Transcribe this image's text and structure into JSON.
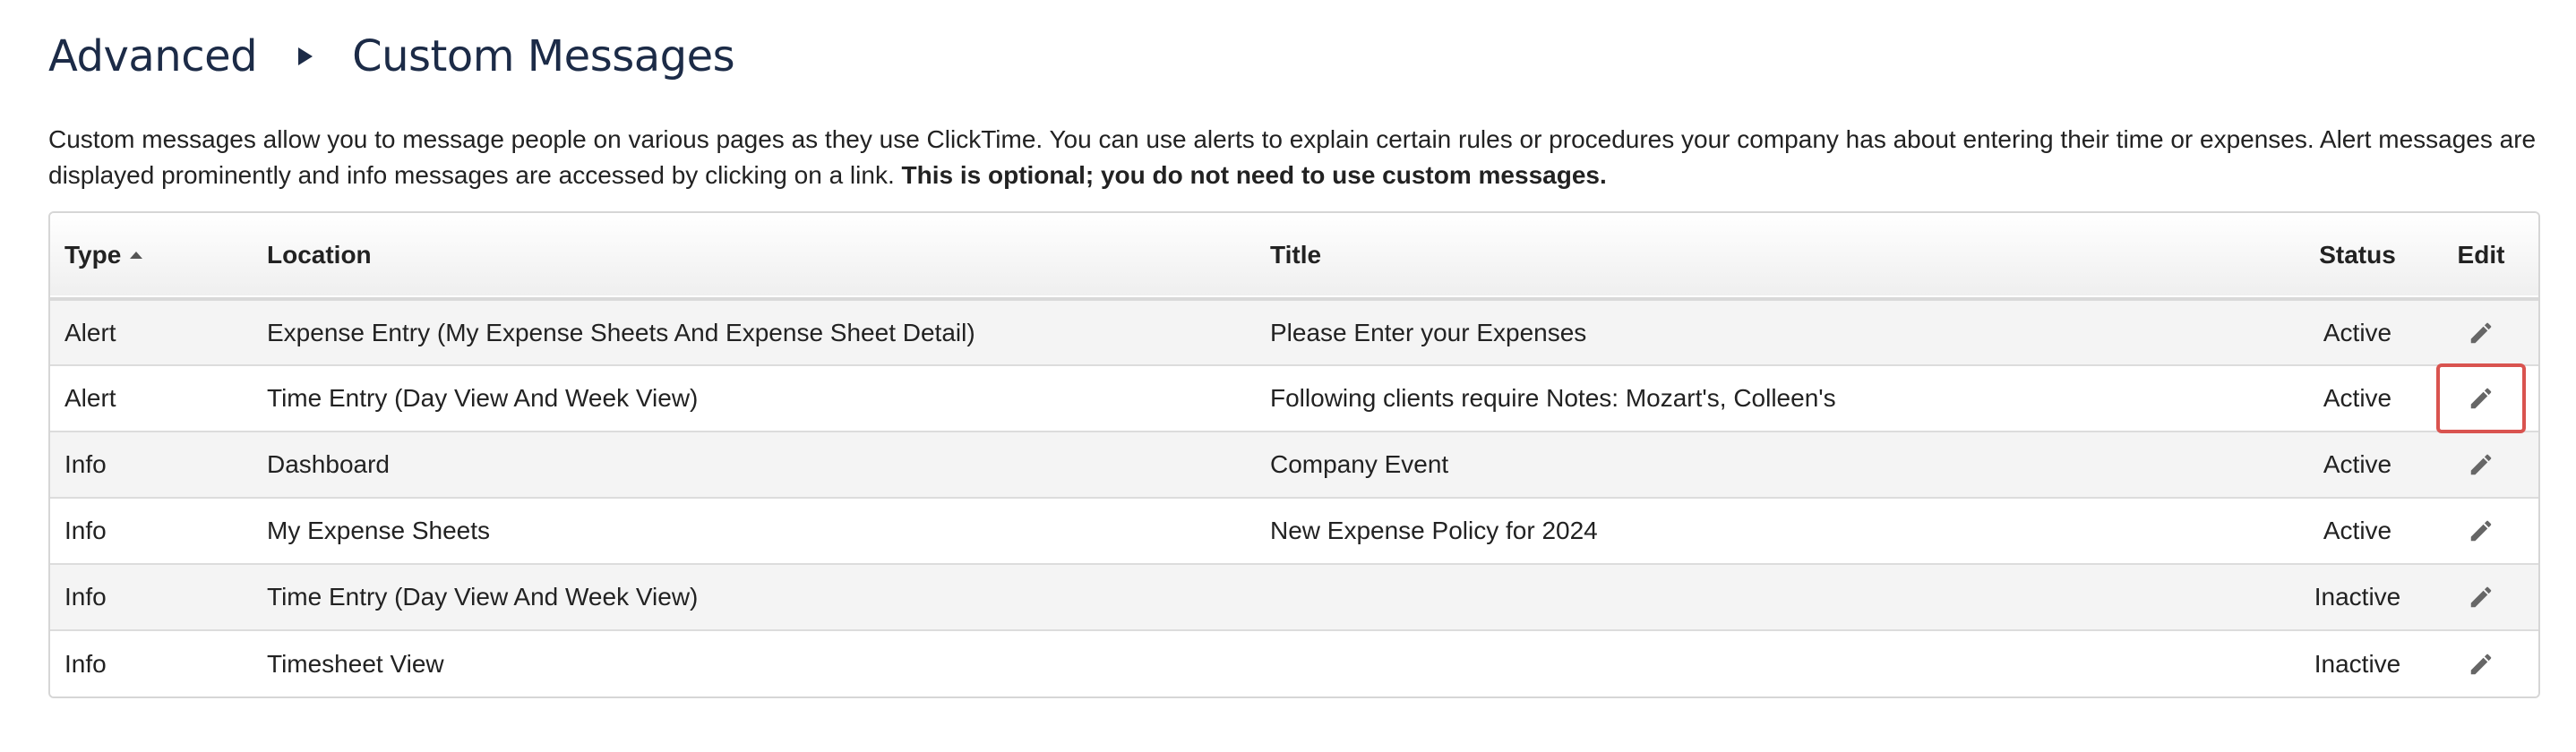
{
  "breadcrumb": {
    "parent": "Advanced",
    "current": "Custom Messages"
  },
  "description": {
    "text": "Custom messages allow you to message people on various pages as they use ClickTime. You can use alerts to explain certain rules or procedures your company has about entering their time or expenses. Alert messages are displayed prominently and info messages are accessed by clicking on a link. ",
    "bold": "This is optional; you do not need to use custom messages."
  },
  "table": {
    "headers": {
      "type": "Type",
      "location": "Location",
      "title": "Title",
      "status": "Status",
      "edit": "Edit"
    },
    "sort": {
      "column": "type",
      "direction": "ascending"
    },
    "rows": [
      {
        "type": "Alert",
        "location": "Expense Entry (My Expense Sheets And Expense Sheet Detail)",
        "title": "Please Enter your Expenses",
        "status": "Active"
      },
      {
        "type": "Alert",
        "location": "Time Entry (Day View And Week View)",
        "title": "Following clients require Notes: Mozart's, Colleen's",
        "status": "Active"
      },
      {
        "type": "Info",
        "location": "Dashboard",
        "title": "Company Event",
        "status": "Active"
      },
      {
        "type": "Info",
        "location": "My Expense Sheets",
        "title": "New Expense Policy for 2024",
        "status": "Active"
      },
      {
        "type": "Info",
        "location": "Time Entry (Day View And Week View)",
        "title": "",
        "status": "Inactive"
      },
      {
        "type": "Info",
        "location": "Timesheet View",
        "title": "",
        "status": "Inactive"
      }
    ]
  },
  "highlight": {
    "row_index": 1,
    "color": "#d9534f"
  },
  "icons": {
    "edit": "pencil-icon",
    "sort": "sort-ascending-icon"
  }
}
